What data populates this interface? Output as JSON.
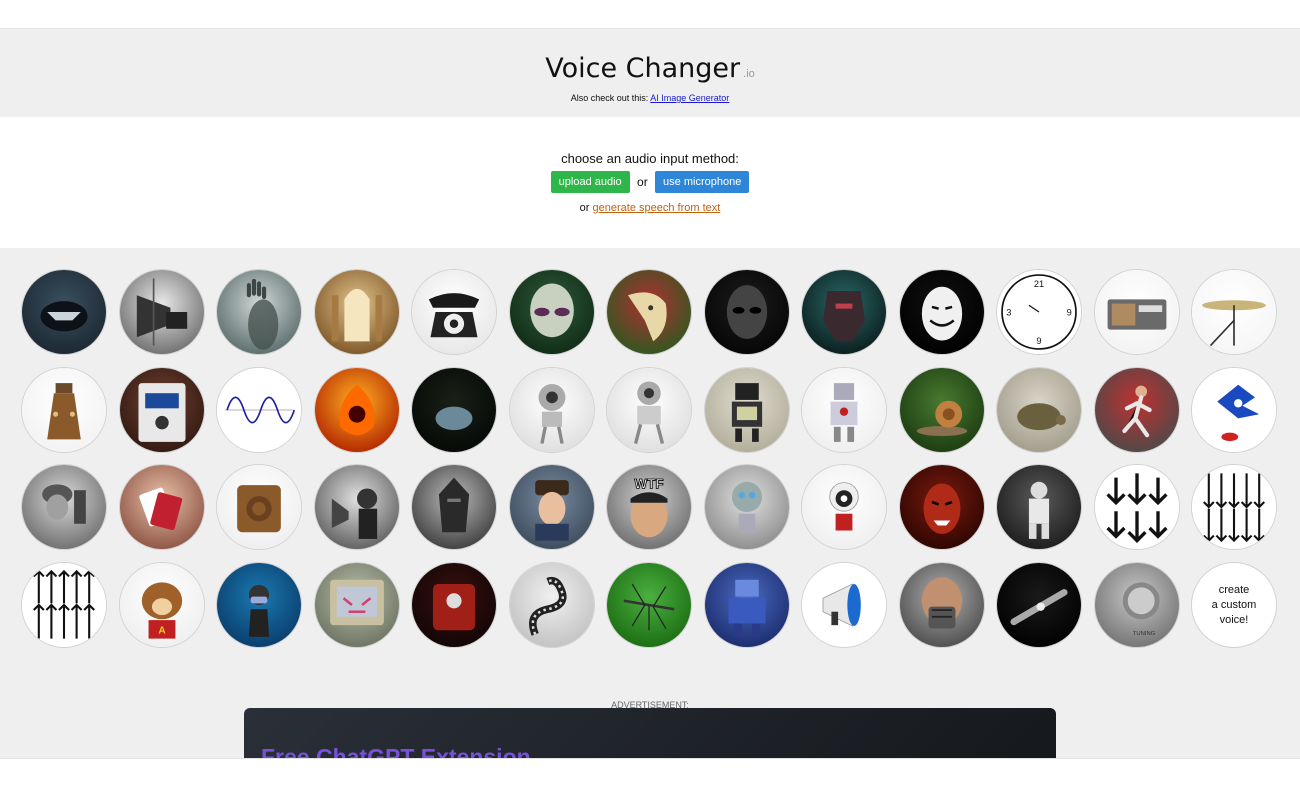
{
  "header": {
    "title": "Voice Changer",
    "suffix": ".io",
    "also_prefix": "Also check out this: ",
    "also_link": "AI Image Generator"
  },
  "input": {
    "prompt": "choose an audio input method:",
    "upload_label": "upload audio",
    "or1": "or",
    "mic_label": "use microphone",
    "or2": "or ",
    "tts_label": "generate speech from text"
  },
  "voices": [
    {
      "name": "voice-beast",
      "icon": "snarling-creature"
    },
    {
      "name": "voice-gramophone",
      "icon": "gramophone"
    },
    {
      "name": "voice-ghost",
      "icon": "ghost-hand"
    },
    {
      "name": "voice-cathedral",
      "icon": "cathedral-interior"
    },
    {
      "name": "voice-telephone",
      "icon": "rotary-telephone"
    },
    {
      "name": "voice-alien",
      "icon": "grey-alien"
    },
    {
      "name": "voice-melting-clock",
      "icon": "melting-clock"
    },
    {
      "name": "voice-dark-alien",
      "icon": "dark-alien"
    },
    {
      "name": "voice-robot-helmet",
      "icon": "robot-helmet"
    },
    {
      "name": "voice-anonymous",
      "icon": "anonymous-mask"
    },
    {
      "name": "voice-reversed-clock",
      "icon": "reversed-clock"
    },
    {
      "name": "voice-radio",
      "icon": "vintage-radio"
    },
    {
      "name": "voice-cymbal",
      "icon": "cymbal"
    },
    {
      "name": "voice-dalek",
      "icon": "dalek"
    },
    {
      "name": "voice-pedal",
      "icon": "effects-pedal"
    },
    {
      "name": "voice-sine-wave",
      "icon": "sine-wave"
    },
    {
      "name": "voice-fire",
      "icon": "fire-demon"
    },
    {
      "name": "voice-cave",
      "icon": "cave"
    },
    {
      "name": "voice-robot-white",
      "icon": "white-robot"
    },
    {
      "name": "voice-robot-white-2",
      "icon": "white-robot-2"
    },
    {
      "name": "voice-tv-robot",
      "icon": "tv-robot"
    },
    {
      "name": "voice-toy-robot",
      "icon": "toy-robot"
    },
    {
      "name": "voice-snail",
      "icon": "snail"
    },
    {
      "name": "voice-tortoise",
      "icon": "tortoise"
    },
    {
      "name": "voice-sprinter",
      "icon": "sprinter"
    },
    {
      "name": "voice-hedgehog",
      "icon": "blue-hedgehog"
    },
    {
      "name": "voice-radio-soldier",
      "icon": "soldier-radio"
    },
    {
      "name": "voice-cards",
      "icon": "playing-cards"
    },
    {
      "name": "voice-speaker",
      "icon": "wooden-speaker"
    },
    {
      "name": "voice-phonograph",
      "icon": "phonograph-man"
    },
    {
      "name": "voice-dark-knight",
      "icon": "armored-knight"
    },
    {
      "name": "voice-soldier-hat",
      "icon": "fur-hat-man"
    },
    {
      "name": "voice-wtf",
      "icon": "wtf-man",
      "text": "WTF"
    },
    {
      "name": "voice-gir",
      "icon": "silver-robot"
    },
    {
      "name": "voice-kirobo",
      "icon": "mini-robot"
    },
    {
      "name": "voice-demon",
      "icon": "red-demon"
    },
    {
      "name": "voice-astronaut",
      "icon": "astronaut"
    },
    {
      "name": "voice-arrows-down",
      "icon": "arrows-down"
    },
    {
      "name": "voice-arrows-down-many",
      "icon": "arrows-down-many"
    },
    {
      "name": "voice-arrows-up",
      "icon": "arrows-up"
    },
    {
      "name": "voice-chipmunk",
      "icon": "chipmunk"
    },
    {
      "name": "voice-diver",
      "icon": "scuba-diver"
    },
    {
      "name": "voice-retro-computer",
      "icon": "retro-computer"
    },
    {
      "name": "voice-red-machine",
      "icon": "red-machine"
    },
    {
      "name": "voice-snake",
      "icon": "robot-snake"
    },
    {
      "name": "voice-mosquito",
      "icon": "mosquito"
    },
    {
      "name": "voice-mech",
      "icon": "blue-mech"
    },
    {
      "name": "voice-megaphone",
      "icon": "megaphone"
    },
    {
      "name": "voice-bane",
      "icon": "masked-man"
    },
    {
      "name": "voice-lightsaber",
      "icon": "dark-device"
    },
    {
      "name": "voice-knob",
      "icon": "tuning-knob"
    },
    {
      "name": "custom-voice",
      "icon": "custom",
      "text": "create\na custom\nvoice!"
    }
  ],
  "ad": {
    "label": "ADVERTISEMENT:",
    "headline": "Free ChatGPT Extension"
  },
  "colors": {
    "upload_button": "#2fb64a",
    "mic_button": "#2d86d8",
    "tts_link": "#c0620f",
    "ad_headline": "#7a4fdc"
  }
}
